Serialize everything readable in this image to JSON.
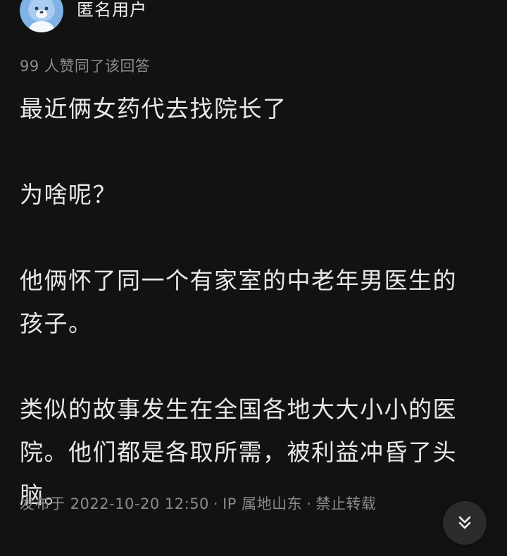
{
  "author": {
    "name": "匿名用户",
    "avatar_icon": "anonymous-avatar-icon"
  },
  "votes": {
    "text": "99 人赞同了该回答"
  },
  "answer": {
    "paragraphs": [
      "最近俩女药代去找院长了",
      "为啥呢？",
      "他俩怀了同一个有家室的中老年男医生的孩子。",
      "类似的故事发生在全国各地大大小小的医院。他们都是各取所需，被利益冲昏了头脑。"
    ]
  },
  "meta": {
    "published": "发布于 2022-10-20 12:50",
    "ip_location": "IP 属地山东",
    "copyright": "禁止转载",
    "separator": "·"
  },
  "fab": {
    "icon": "double-chevron-down-icon"
  },
  "colors": {
    "background": "#121212",
    "text": "#e8e8e8",
    "muted": "#8b8b8b",
    "fab": "#2b2b2b",
    "avatar": "#7fb2e5"
  }
}
